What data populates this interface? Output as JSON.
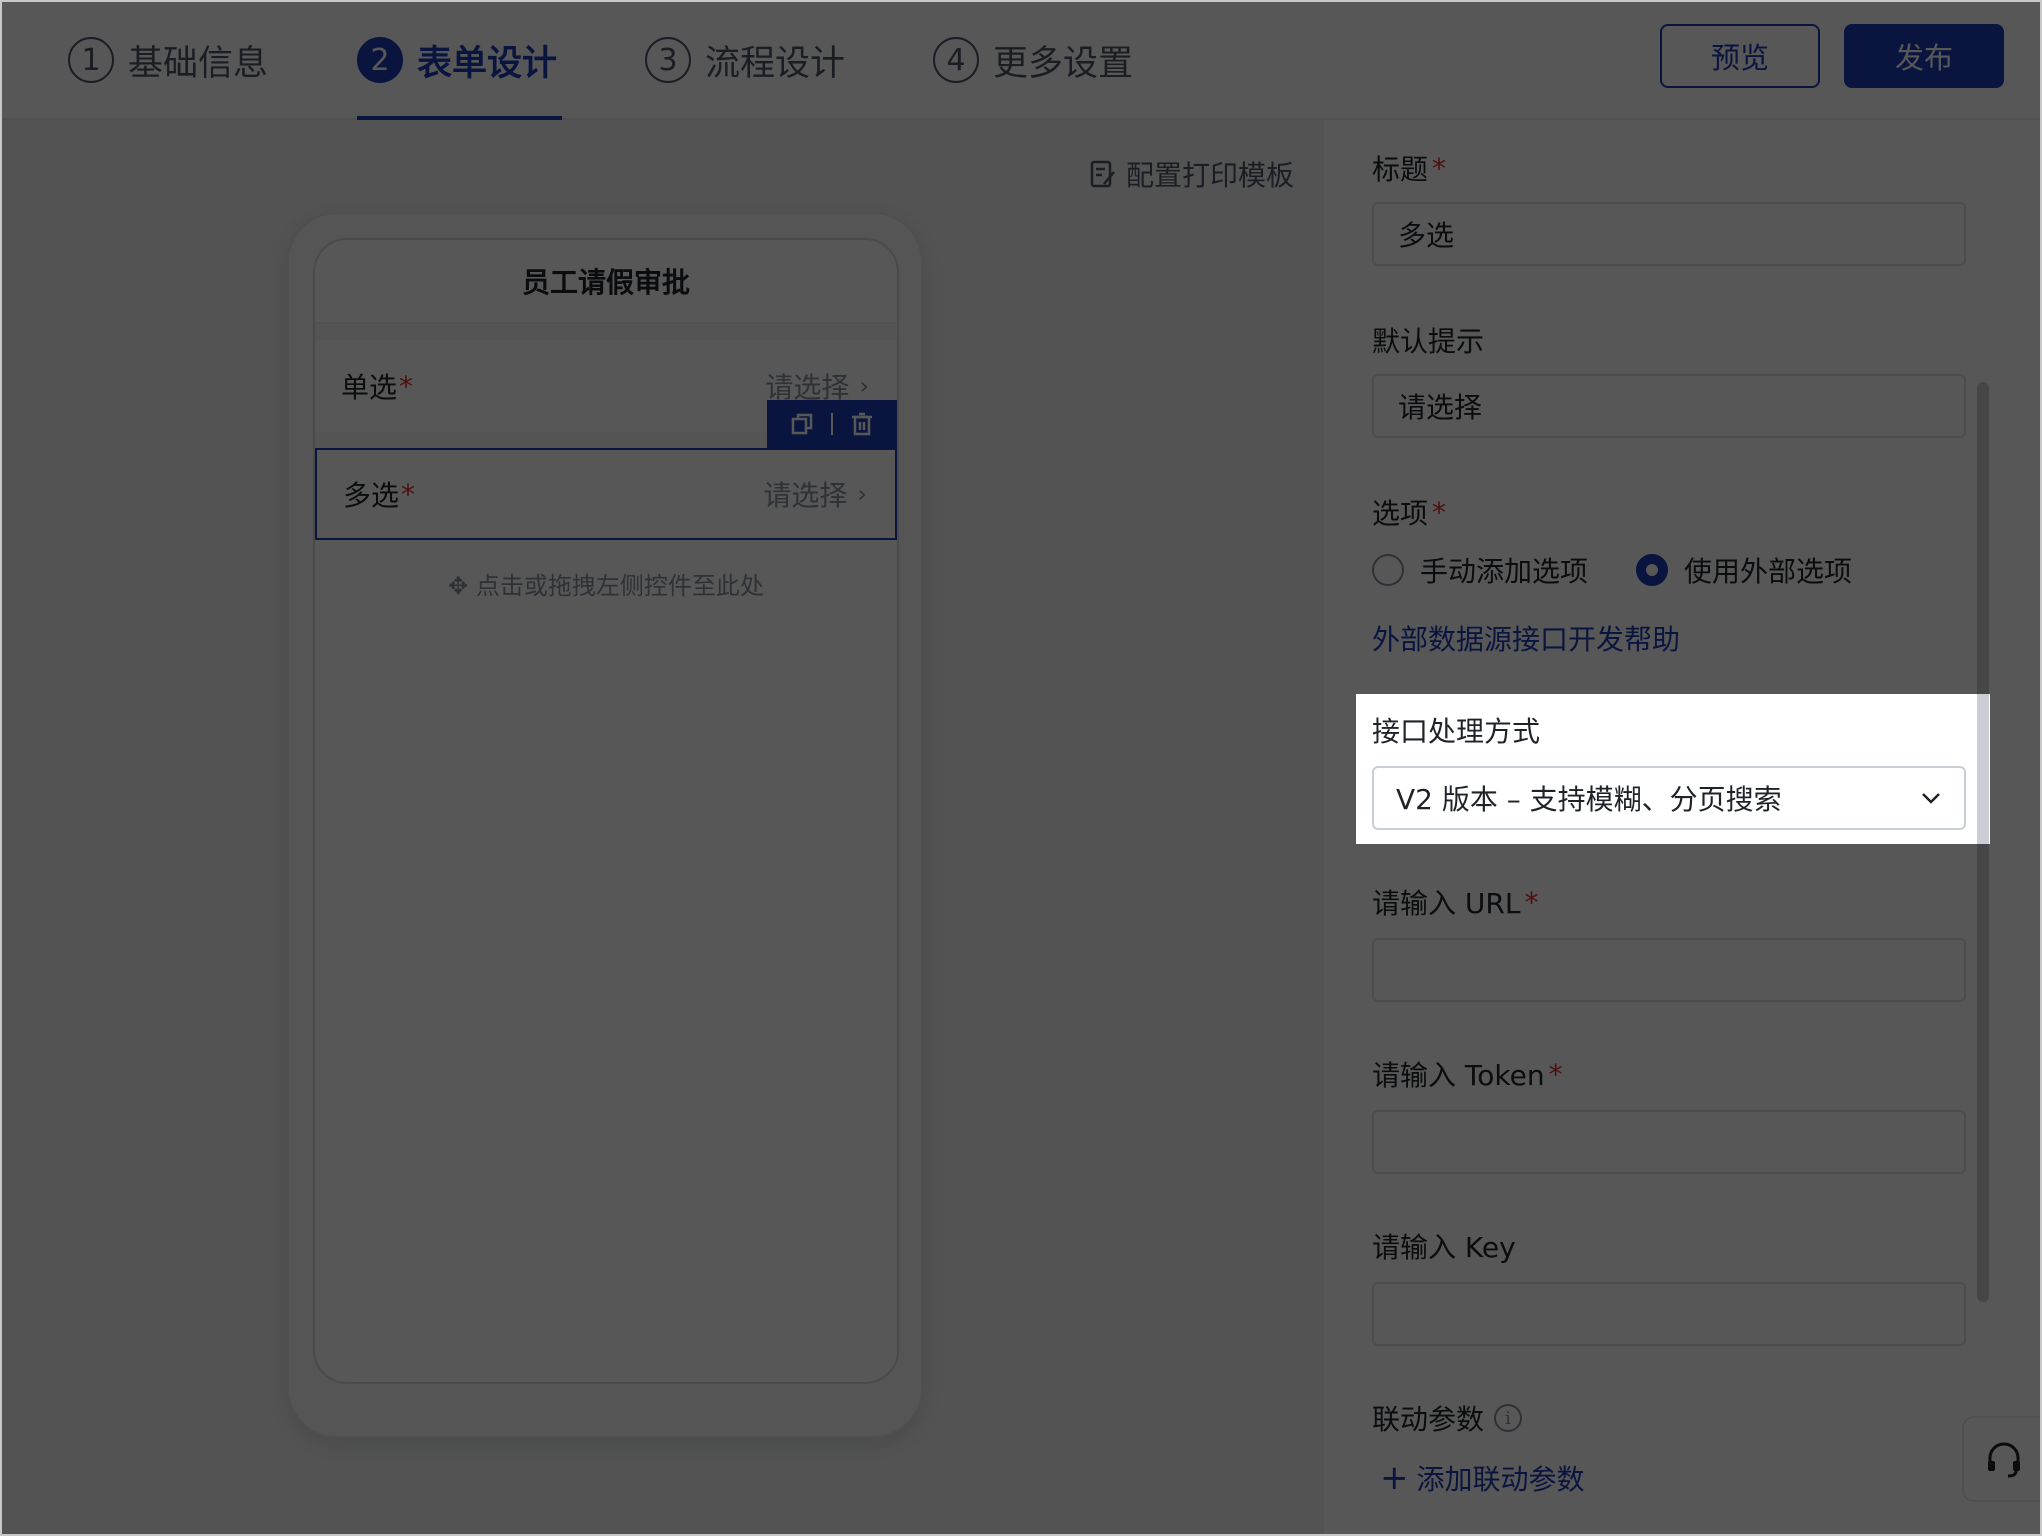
{
  "header": {
    "steps": [
      {
        "num": "1",
        "label": "基础信息"
      },
      {
        "num": "2",
        "label": "表单设计"
      },
      {
        "num": "3",
        "label": "流程设计"
      },
      {
        "num": "4",
        "label": "更多设置"
      }
    ],
    "preview_label": "预览",
    "publish_label": "发布"
  },
  "canvas": {
    "print_template_label": "配置打印模板",
    "form_title": "员工请假审批",
    "fields": [
      {
        "label": "单选",
        "required": "*",
        "placeholder": "请选择"
      },
      {
        "label": "多选",
        "required": "*",
        "placeholder": "请选择"
      }
    ],
    "drop_hint": "点击或拖拽左侧控件至此处"
  },
  "panel": {
    "title_label": "标题",
    "title_value": "多选",
    "default_hint_label": "默认提示",
    "default_hint_value": "请选择",
    "options_label": "选项",
    "option_manual": "手动添加选项",
    "option_external": "使用外部选项",
    "help_link": "外部数据源接口开发帮助",
    "interface_label": "接口处理方式",
    "interface_value": "V2 版本 – 支持模糊、分页搜索",
    "url_label": "请输入 URL",
    "token_label": "请输入 Token",
    "key_label": "请输入 Key",
    "linkage_label": "联动参数",
    "add_linkage": "添加联动参数",
    "required_mark": "*"
  },
  "colors": {
    "accent": "#1f3fb8",
    "required": "#e03131"
  }
}
